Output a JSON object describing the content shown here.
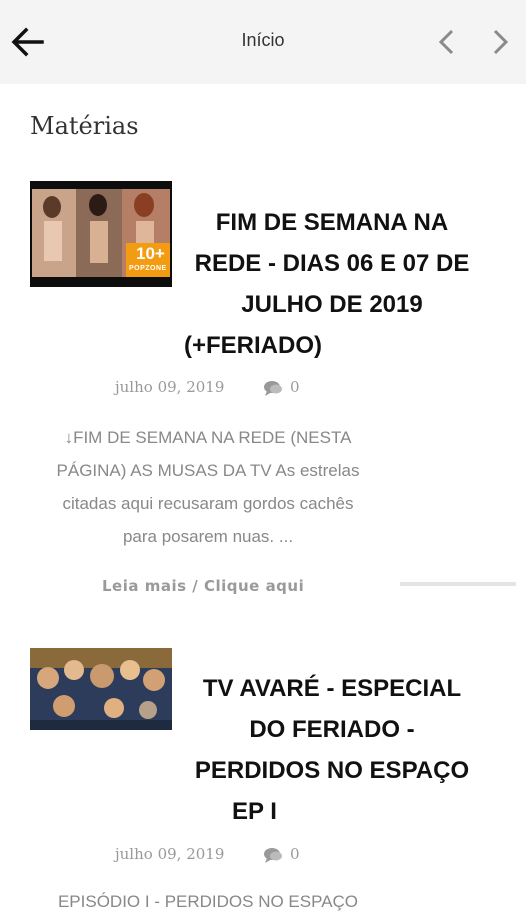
{
  "header": {
    "title": "Início",
    "back_icon": "arrow-left-icon",
    "prev_icon": "chevron-left-icon",
    "next_icon": "chevron-right-icon"
  },
  "section_title": "Matérias",
  "posts": [
    {
      "title_lines": [
        "FIM DE SEMANA NA",
        "REDE - DIAS 06 E 07 DE",
        "JULHO DE 2019",
        "(+FERIADO)"
      ],
      "date": "julho 09, 2019",
      "comments": "0",
      "excerpt_lines": [
        "↓FIM DE SEMANA NA REDE (NESTA",
        "PÁGINA) AS MUSAS DA TV As estrelas",
        "citadas aqui recusaram gordos cachês",
        "para posarem nuas. ..."
      ],
      "read_more": "Leia mais / Clique aqui",
      "thumb_badge": "10+",
      "thumb_badge_sub": "POPZONE"
    },
    {
      "title_lines": [
        "TV AVARÉ - ESPECIAL",
        "DO FERIADO -",
        "PERDIDOS NO ESPAÇO",
        "EP I"
      ],
      "date": "julho 09, 2019",
      "comments": "0",
      "excerpt_lines": [
        "EPISÓDIO I - PERDIDOS NO ESPAÇO"
      ]
    }
  ],
  "colors": {
    "header_bg": "#f4f4f4",
    "badge_orange": "#f39c12",
    "meta_gray": "#999999"
  }
}
